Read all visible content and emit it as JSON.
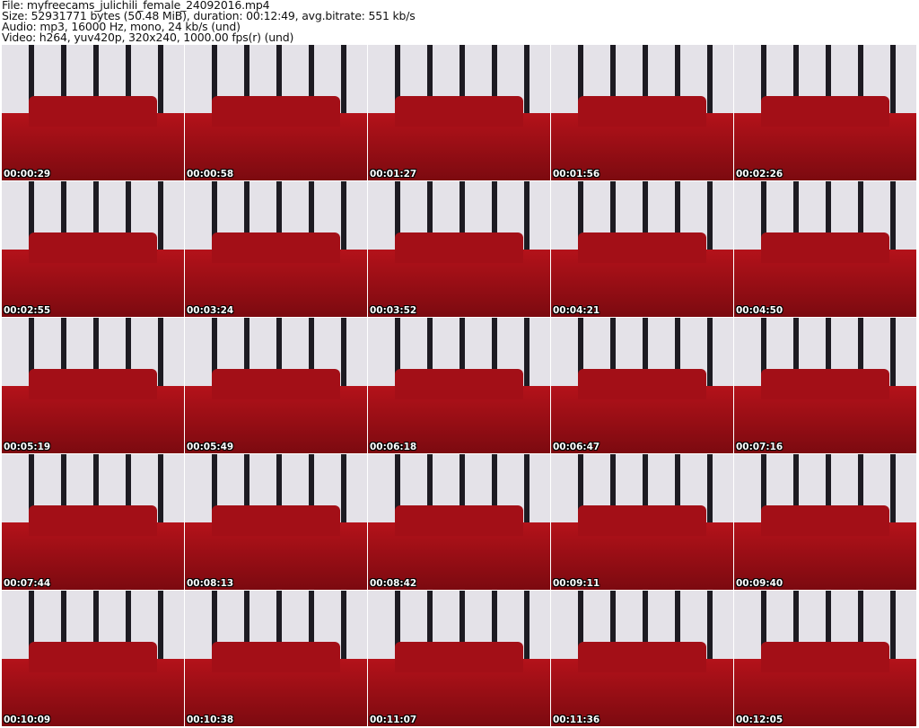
{
  "header": {
    "file": "File: myfreecams_julichili_female_24092016.mp4",
    "size": "Size: 52931771 bytes (50.48 MiB), duration: 00:12:49, avg.bitrate: 551 kb/s",
    "audio": "Audio: mp3, 16000 Hz, mono, 24 kb/s (und)",
    "video": "Video: h264, yuv420p, 320x240, 1000.00 fps(r) (und)"
  },
  "thumbnails": [
    "00:00:29",
    "00:00:58",
    "00:01:27",
    "00:01:56",
    "00:02:26",
    "00:02:55",
    "00:03:24",
    "00:03:52",
    "00:04:21",
    "00:04:50",
    "00:05:19",
    "00:05:49",
    "00:06:18",
    "00:06:47",
    "00:07:16",
    "00:07:44",
    "00:08:13",
    "00:08:42",
    "00:09:11",
    "00:09:40",
    "00:10:09",
    "00:10:38",
    "00:11:07",
    "00:11:36",
    "00:12:05"
  ]
}
